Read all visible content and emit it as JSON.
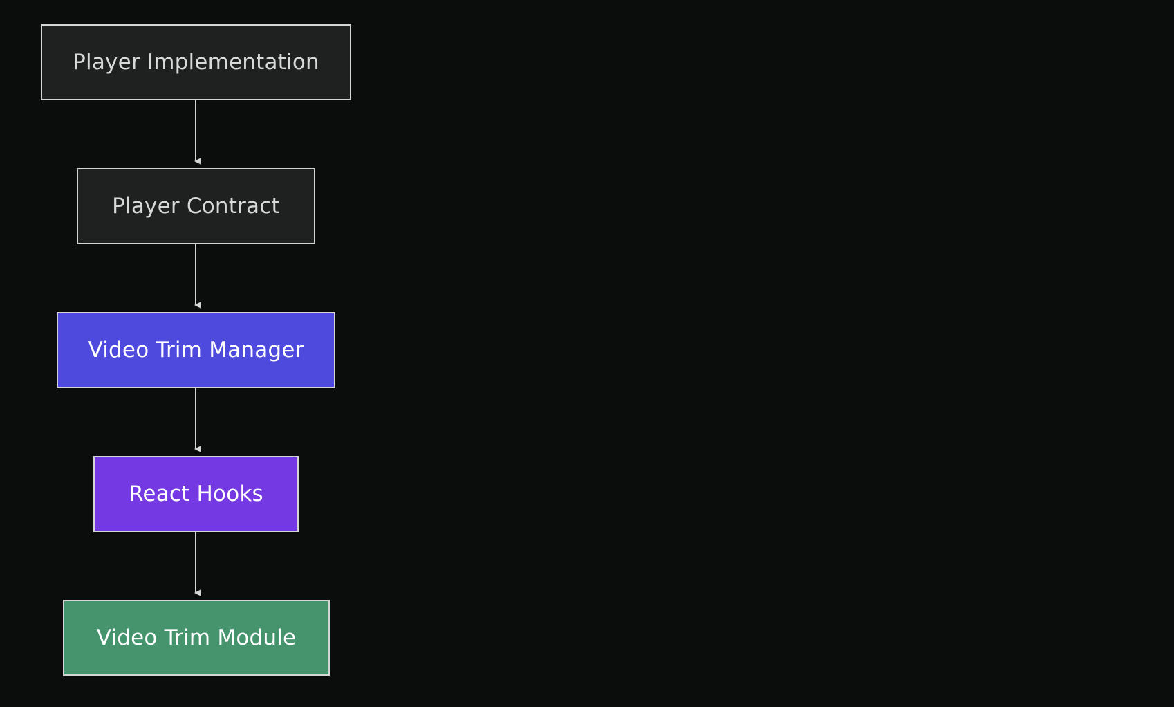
{
  "diagram": {
    "type": "flowchart",
    "direction": "top-down",
    "colors": {
      "background": "#0b0d0d",
      "edge": "#d4d4d4",
      "node_border": "#d4d4d4",
      "dark_fill": "#1f2121",
      "blue_fill": "#4f4ade",
      "purple_fill": "#7439e2",
      "green_fill": "#45946d"
    },
    "nodes": [
      {
        "id": "player-implementation",
        "label": "Player Implementation",
        "fill": "#1f2121"
      },
      {
        "id": "player-contract",
        "label": "Player Contract",
        "fill": "#1f2121"
      },
      {
        "id": "video-trim-manager",
        "label": "Video Trim Manager",
        "fill": "#4f4ade"
      },
      {
        "id": "react-hooks",
        "label": "React Hooks",
        "fill": "#7439e2"
      },
      {
        "id": "video-trim-module",
        "label": "Video Trim Module",
        "fill": "#45946d"
      }
    ],
    "edges": [
      {
        "from": "player-implementation",
        "to": "player-contract"
      },
      {
        "from": "player-contract",
        "to": "video-trim-manager"
      },
      {
        "from": "video-trim-manager",
        "to": "react-hooks"
      },
      {
        "from": "react-hooks",
        "to": "video-trim-module"
      }
    ]
  }
}
